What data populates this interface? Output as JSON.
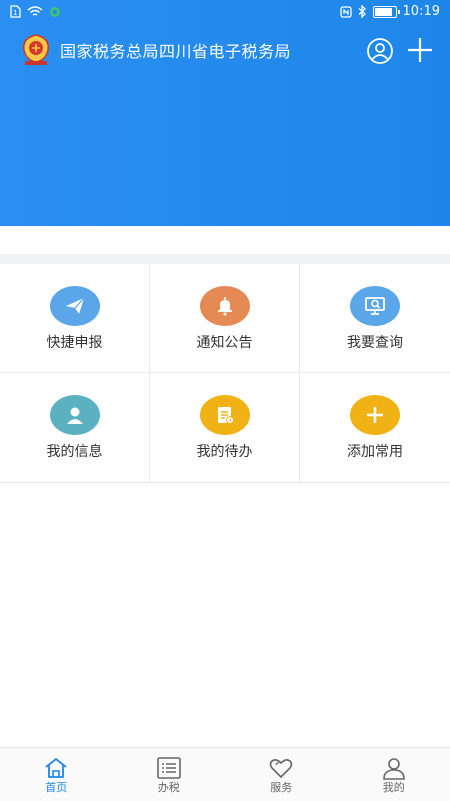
{
  "status_bar": {
    "time": "10:19",
    "battery_level": 0.9
  },
  "header": {
    "title": "国家税务总局四川省电子税务局"
  },
  "grid": [
    {
      "label": "快捷申报",
      "icon": "paper-plane-icon",
      "color": "#5aa6e8"
    },
    {
      "label": "通知公告",
      "icon": "bell-icon",
      "color": "#e58a55"
    },
    {
      "label": "我要查询",
      "icon": "monitor-search-icon",
      "color": "#5aa6e8"
    },
    {
      "label": "我的信息",
      "icon": "person-icon",
      "color": "#5bb1c0"
    },
    {
      "label": "我的待办",
      "icon": "document-icon",
      "color": "#f0b214"
    },
    {
      "label": "添加常用",
      "icon": "plus-icon",
      "color": "#f0b214"
    }
  ],
  "tabs": [
    {
      "label": "首页",
      "icon": "home-icon",
      "active": true
    },
    {
      "label": "办税",
      "icon": "list-icon",
      "active": false
    },
    {
      "label": "服务",
      "icon": "heart-icon",
      "active": false
    },
    {
      "label": "我的",
      "icon": "user-icon",
      "active": false
    }
  ],
  "colors": {
    "brand_blue": "#1e86ea",
    "active_tab": "#1f86e6"
  }
}
